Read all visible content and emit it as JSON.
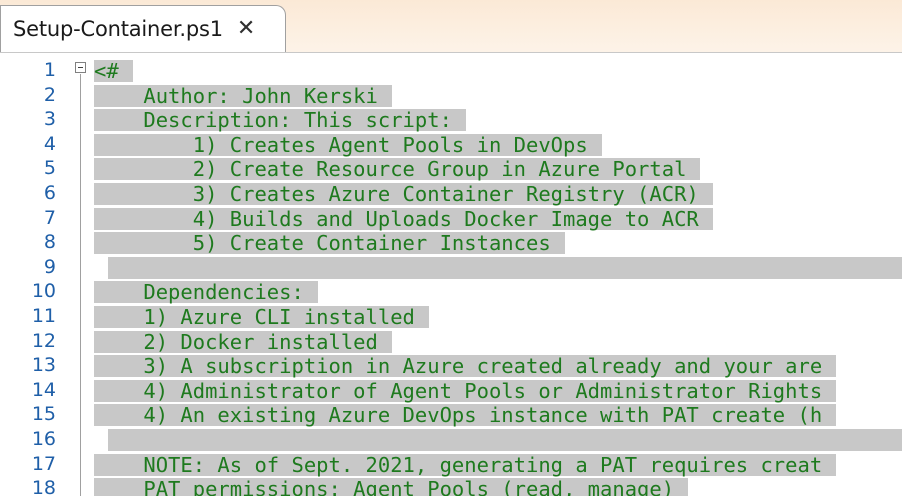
{
  "tab": {
    "title": "Setup-Container.ps1",
    "close_glyph": "✕"
  },
  "lines": [
    {
      "num": "1",
      "text": "<#"
    },
    {
      "num": "2",
      "text": "    Author: John Kerski"
    },
    {
      "num": "3",
      "text": "    Description: This script:"
    },
    {
      "num": "4",
      "text": "        1) Creates Agent Pools in DevOps"
    },
    {
      "num": "5",
      "text": "        2) Create Resource Group in Azure Portal"
    },
    {
      "num": "6",
      "text": "        3) Creates Azure Container Registry (ACR)"
    },
    {
      "num": "7",
      "text": "        4) Builds and Uploads Docker Image to ACR"
    },
    {
      "num": "8",
      "text": "        5) Create Container Instances"
    },
    {
      "num": "9",
      "text": ""
    },
    {
      "num": "10",
      "text": "    Dependencies:"
    },
    {
      "num": "11",
      "text": "    1) Azure CLI installed"
    },
    {
      "num": "12",
      "text": "    2) Docker installed"
    },
    {
      "num": "13",
      "text": "    3) A subscription in Azure created already and your are"
    },
    {
      "num": "14",
      "text": "    4) Administrator of Agent Pools or Administrator Rights"
    },
    {
      "num": "15",
      "text": "    4) An existing Azure DevOps instance with PAT create (h"
    },
    {
      "num": "16",
      "text": ""
    },
    {
      "num": "17",
      "text": "    NOTE: As of Sept. 2021, generating a PAT requires creat"
    },
    {
      "num": "18",
      "text": "    PAT permissions: Agent Pools (read, manage)"
    }
  ]
}
